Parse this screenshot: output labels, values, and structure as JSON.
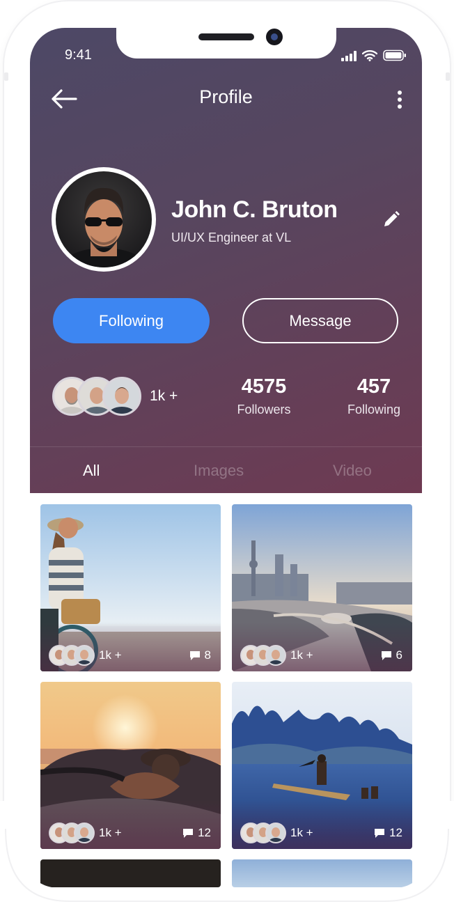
{
  "status_bar": {
    "time": "9:41"
  },
  "topbar": {
    "title": "Profile",
    "back_icon": "arrow-left-icon",
    "more_icon": "more-vertical-icon"
  },
  "profile": {
    "name": "John C. Bruton",
    "role": "UI/UX Engineer at VL",
    "edit_icon": "pencil-icon"
  },
  "actions": {
    "following_label": "Following",
    "message_label": "Message"
  },
  "stats": {
    "friends_count": "1k +",
    "followers_value": "4575",
    "followers_label": "Followers",
    "following_value": "457",
    "following_label": "Following"
  },
  "tabs": [
    {
      "label": "All",
      "active": true
    },
    {
      "label": "Images",
      "active": false
    },
    {
      "label": "Video",
      "active": false
    }
  ],
  "posts": [
    {
      "scene": "woman-bicycle-beach",
      "likes": "1k +",
      "comments": "8"
    },
    {
      "scene": "city-skyline-river",
      "likes": "1k +",
      "comments": "6"
    },
    {
      "scene": "sunset-convertible",
      "likes": "1k +",
      "comments": "12"
    },
    {
      "scene": "mountains-fisherman",
      "likes": "1k +",
      "comments": "12"
    }
  ],
  "colors": {
    "header_gradient_start": "#4d4866",
    "header_gradient_end": "#6e3a52",
    "accent_blue": "#3d86f2"
  }
}
